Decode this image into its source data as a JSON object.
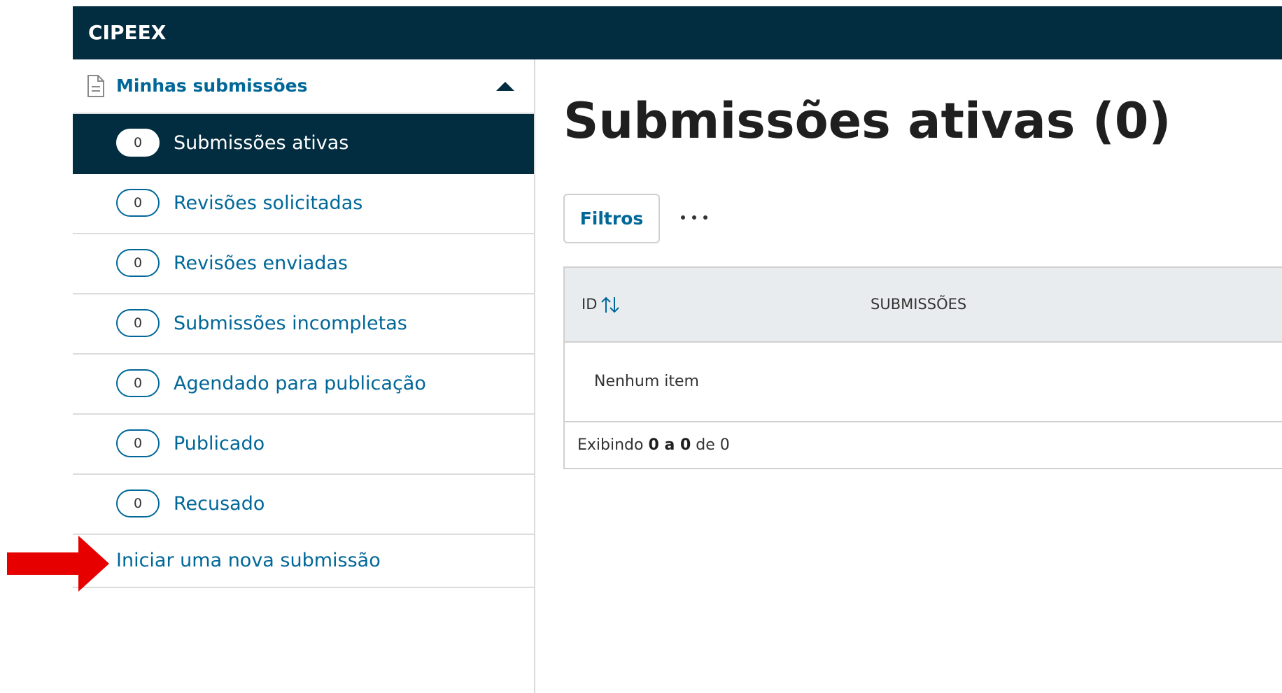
{
  "header": {
    "brand": "CIPEEX"
  },
  "sidebar": {
    "section_title": "Minhas submissões",
    "section_icon": "document-icon",
    "collapse_icon": "caret-up-icon",
    "items": [
      {
        "count": "0",
        "label": "Submissões ativas",
        "active": true
      },
      {
        "count": "0",
        "label": "Revisões solicitadas",
        "active": false
      },
      {
        "count": "0",
        "label": "Revisões enviadas",
        "active": false
      },
      {
        "count": "0",
        "label": "Submissões incompletas",
        "active": false
      },
      {
        "count": "0",
        "label": "Agendado para publicação",
        "active": false
      },
      {
        "count": "0",
        "label": "Publicado",
        "active": false
      },
      {
        "count": "0",
        "label": "Recusado",
        "active": false
      }
    ],
    "new_submission_label": "Iniciar uma nova submissão"
  },
  "main": {
    "title": "Submissões ativas (0)",
    "filters_label": "Filtros",
    "more_icon": "ellipsis-icon",
    "table": {
      "columns": {
        "id": "ID",
        "submissions": "SUBMISSÕES"
      },
      "sort_icon": "sort-arrows-icon",
      "empty_text": "Nenhum item",
      "footer": {
        "prefix": "Exibindo",
        "range": "0 a 0",
        "of_word": "de",
        "total": "0"
      }
    }
  },
  "annotation": {
    "arrow_color": "#e60000",
    "arrow_icon": "right-arrow-icon"
  },
  "colors": {
    "header_bg": "#022c3f",
    "link": "#006798",
    "border": "#dcdcdc"
  }
}
